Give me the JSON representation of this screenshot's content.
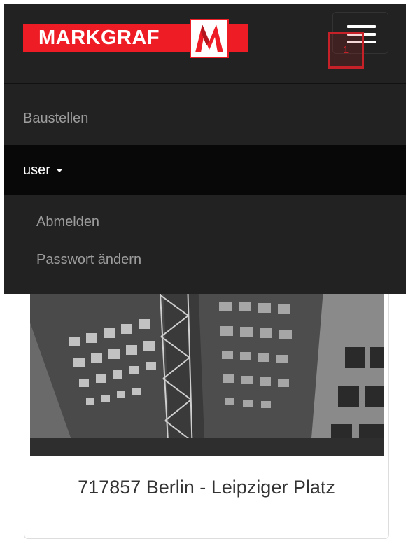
{
  "navbar": {
    "brand_text": "MARKGRAF",
    "badge_text": "1",
    "toggle_icon": "hamburger-icon"
  },
  "menu": {
    "items": [
      {
        "label": "Baustellen"
      },
      {
        "label": "user",
        "expanded": true
      },
      {
        "label": "Abmelden"
      },
      {
        "label": "Passwort ändern"
      }
    ]
  },
  "card": {
    "title": "717857 Berlin - Leipziger Platz",
    "image": "construction-site-photo"
  },
  "colors": {
    "brand_red": "#ee1c25",
    "navbar_bg": "#222222",
    "active_bg": "#080808",
    "menu_text": "#9d9d9d"
  }
}
